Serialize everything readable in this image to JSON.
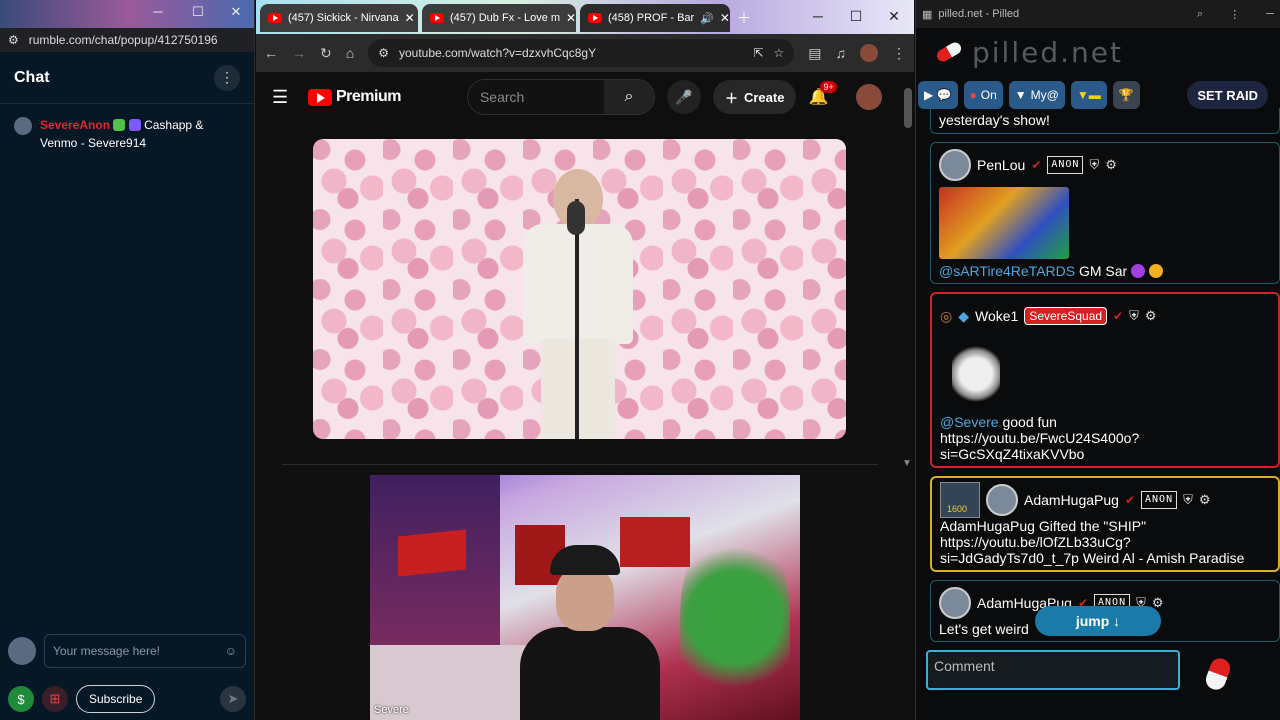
{
  "rumble": {
    "url": "rumble.com/chat/popup/412750196",
    "chat_title": "Chat",
    "message": {
      "user": "SevereAnon",
      "text": "Cashapp & Venmo - Severe914"
    },
    "input_placeholder": "Your message here!",
    "subscribe_label": "Subscribe"
  },
  "chrome": {
    "tabs": [
      {
        "label": "(457) Sickick - Nirvana"
      },
      {
        "label": "(457) Dub Fx - Love m"
      },
      {
        "label": "(458) PROF - Bar"
      }
    ],
    "url": "youtube.com/watch?v=dzxvhCqc8gY"
  },
  "youtube": {
    "brand": "Premium",
    "search_placeholder": "Search",
    "create_label": "Create",
    "notif_count": "9+",
    "stream_label": "Severe"
  },
  "pilled": {
    "window_title": "pilled.net - Pilled",
    "logo": "pilled.net",
    "toolbar": {
      "on_label": "On",
      "my_label": "My@",
      "raid_label": "SET RAID"
    },
    "messages": [
      {
        "text": "yesterday's show!"
      },
      {
        "user": "PenLou",
        "mention": "@sARTire4ReTARDS",
        "text": "GM Sar"
      },
      {
        "user": "Woke1",
        "tag": "SevereSquad",
        "mention": "@Severe",
        "text": "good fun",
        "link1": "https://youtu.be/FwcU24S400o?",
        "link2": "si=GcSXqZ4tixaKVVbo"
      },
      {
        "user": "AdamHugaPug",
        "level": "1600",
        "line1": "AdamHugaPug Gifted the \"SHIP\"",
        "line2": "https://youtu.be/lOfZLb33uCg?",
        "line3": "si=JdGadyTs7d0_t_7p Weird Al - Amish Paradise"
      },
      {
        "user": "AdamHugaPug",
        "text": "Let's get weird"
      }
    ],
    "anon_badge": "ANON",
    "jump_label": "jump ↓",
    "comment_placeholder": "Comment"
  },
  "colors": {
    "rumble_bg": "#061726",
    "yt_red": "#ff0000",
    "pilled_accent": "#3ab0d8",
    "squad_red": "#d42020",
    "gold": "#d8b020"
  }
}
